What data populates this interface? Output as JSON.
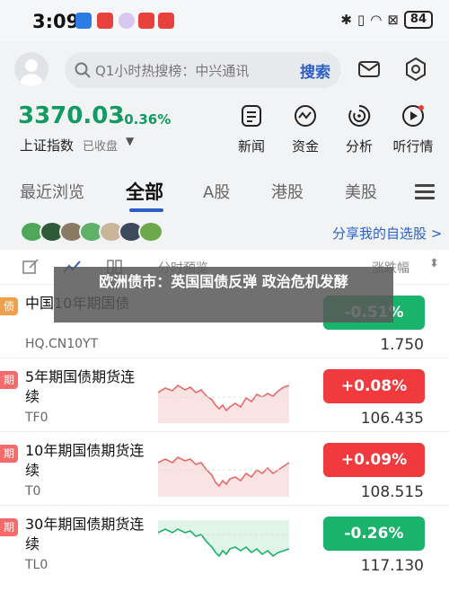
{
  "status_bar": {
    "time": "3:09",
    "battery": "84"
  },
  "search": {
    "placeholder": "Q1小时热搜榜：中兴通讯",
    "button_label": "搜索"
  },
  "index": {
    "value": "3370.03",
    "change": "-0.36%",
    "name": "上证指数",
    "status": "已收盘"
  },
  "quick_functions": [
    {
      "label": "新闻",
      "icon": "news-icon"
    },
    {
      "label": "资金",
      "icon": "fund-icon"
    },
    {
      "label": "分析",
      "icon": "analysis-icon"
    },
    {
      "label": "听行情",
      "icon": "listen-icon"
    }
  ],
  "tabs": [
    {
      "label": "最近浏览"
    },
    {
      "label": "全部"
    },
    {
      "label": "A股"
    },
    {
      "label": "港股"
    },
    {
      "label": "美股"
    }
  ],
  "share_link": "分享我的自选股 >",
  "list_header": {
    "chart_col": "分时预览",
    "change_col": "涨跌幅"
  },
  "news_overlay": "欧洲债市：英国国债反弹 政治危机发酵",
  "stocks": [
    {
      "badge": "债",
      "name": "中国10年期国债",
      "code": "HQ.CN10YT",
      "change": "-0.51%",
      "price": "1.750"
    },
    {
      "badge": "期",
      "name": "5年期国债期货连续",
      "code": "TF0",
      "change": "+0.08%",
      "price": "106.435"
    },
    {
      "badge": "期",
      "name": "10年期国债期货连续",
      "code": "T0",
      "change": "+0.09%",
      "price": "108.515"
    },
    {
      "badge": "期",
      "name": "30年期国债期货连续",
      "code": "TL0",
      "change": "-0.26%",
      "price": "117.130"
    }
  ],
  "colors": {
    "up": "#f03a3e",
    "down": "#19b36b",
    "accent": "#2b5fc4",
    "index_green": "#119a63"
  }
}
